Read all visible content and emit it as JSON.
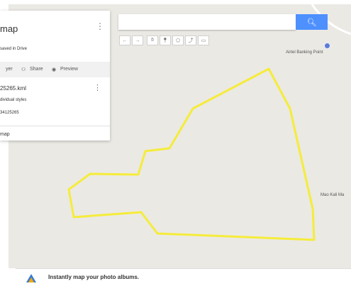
{
  "panel": {
    "title": "map",
    "saved": "saved in Drive",
    "toolbar": {
      "layer": "yer",
      "share": "Share",
      "preview": "Preview"
    },
    "layer_name": "25265.kml",
    "style": "dividual styles",
    "code": "34125265",
    "base_map": "map"
  },
  "search": {
    "value": "",
    "button_icon": "search-icon"
  },
  "tools": [
    "undo-icon",
    "redo-icon",
    "hand-icon",
    "marker-icon",
    "polygon-icon",
    "route-icon",
    "ruler-icon"
  ],
  "map": {
    "labels": [
      "Airtel Banking Point",
      "Mao Kali Ma"
    ],
    "polygon_color": "#f5ec3a",
    "background": "#ebe9e4"
  },
  "banner": {
    "text": "Instantly map your photo albums."
  }
}
